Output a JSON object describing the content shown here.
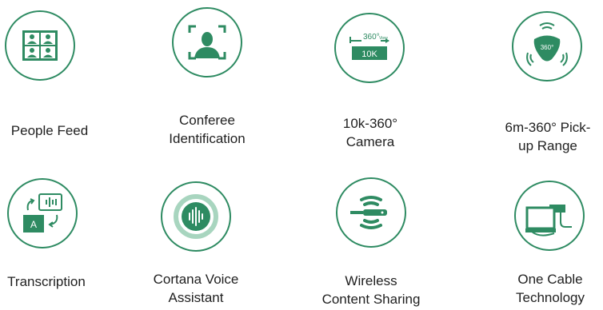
{
  "colors": {
    "accent": "#2e8b62",
    "accent_light": "#a8d5bf",
    "text": "#1f1f1f"
  },
  "features": [
    {
      "icon": "people-feed-grid-icon",
      "lines": [
        "People Feed"
      ]
    },
    {
      "icon": "face-scan-icon",
      "lines": [
        "Conferee",
        "Identification"
      ]
    },
    {
      "icon": "camera-360-icon",
      "lines": [
        "10k-360°",
        "Camera"
      ],
      "icon_text": {
        "top": "360°",
        "sub": "View",
        "box": "10K"
      }
    },
    {
      "icon": "microphone-pickup-icon",
      "lines": [
        "6m-360° Pick-",
        "up Range"
      ],
      "icon_text": {
        "badge": "360°"
      }
    },
    {
      "icon": "transcription-icon",
      "lines": [
        "Transcription"
      ],
      "icon_text": {
        "box": "A"
      }
    },
    {
      "icon": "voice-assistant-icon",
      "lines": [
        "Cortana Voice",
        "Assistant"
      ]
    },
    {
      "icon": "wireless-sharing-icon",
      "lines": [
        "Wireless",
        "Content Sharing"
      ]
    },
    {
      "icon": "one-cable-icon",
      "lines": [
        "One Cable",
        "Technology"
      ]
    }
  ]
}
